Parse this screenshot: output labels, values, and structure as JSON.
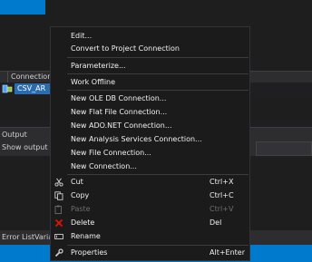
{
  "ide": {
    "connection_manager_header": "Connection M",
    "connection_item": "CSV_AR",
    "output_title": "Output",
    "output_source_label": "Show output fr",
    "bottom_tabs": [
      "Error List",
      "Varia"
    ]
  },
  "menu": {
    "items": [
      {
        "label": "Edit..."
      },
      {
        "label": "Convert to Project Connection"
      },
      {
        "label": "Parameterize..."
      },
      {
        "label": "Work Offline"
      },
      {
        "label": "New OLE DB Connection..."
      },
      {
        "label": "New Flat File Connection..."
      },
      {
        "label": "New ADO.NET Connection..."
      },
      {
        "label": "New Analysis Services Connection..."
      },
      {
        "label": "New File Connection..."
      },
      {
        "label": "New Connection..."
      },
      {
        "label": "Cut",
        "shortcut": "Ctrl+X",
        "icon": "scissors-icon"
      },
      {
        "label": "Copy",
        "shortcut": "Ctrl+C",
        "icon": "copy-icon"
      },
      {
        "label": "Paste",
        "shortcut": "Ctrl+V",
        "icon": "paste-icon",
        "disabled": true
      },
      {
        "label": "Delete",
        "shortcut": "Del",
        "icon": "delete-x-icon"
      },
      {
        "label": "Rename",
        "icon": "rename-icon"
      },
      {
        "label": "Properties",
        "shortcut": "Alt+Enter",
        "icon": "wrench-icon"
      }
    ]
  },
  "colors": {
    "accent": "#007acc",
    "menu_bg": "#1b1b1c",
    "delete_icon": "#e51400"
  }
}
